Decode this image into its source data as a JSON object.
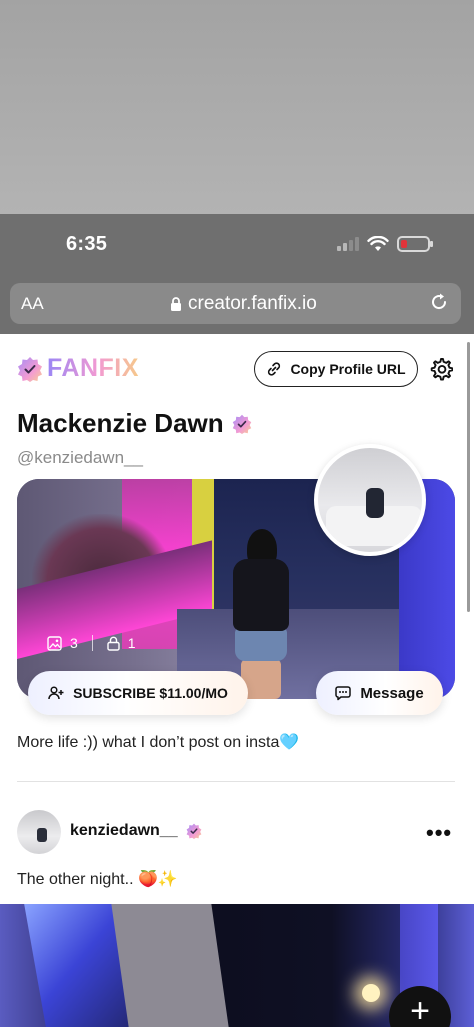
{
  "status_bar": {
    "time": "6:35"
  },
  "browser": {
    "text_size_label": "AA",
    "url": "creator.fanfix.io"
  },
  "header": {
    "logo_text": "FANFIX",
    "copy_profile_label": "Copy Profile URL"
  },
  "profile": {
    "name": "Mackenzie Dawn",
    "handle": "@kenziedawn__",
    "media_count": "3",
    "locked_count": "1",
    "subscribe_label": "SUBSCRIBE $11.00/MO",
    "message_label": "Message",
    "bio": "More life :)) what I don’t post on insta🩵"
  },
  "post": {
    "username": "kenziedawn__",
    "more_label": "•••",
    "caption": "The other night.. 🍑✨"
  },
  "fab": {
    "label": "+"
  },
  "colors": {
    "brand_gradient": [
      "#9b86f5",
      "#f29ad2",
      "#f6c98a"
    ],
    "verified": "#c9a8f0"
  }
}
